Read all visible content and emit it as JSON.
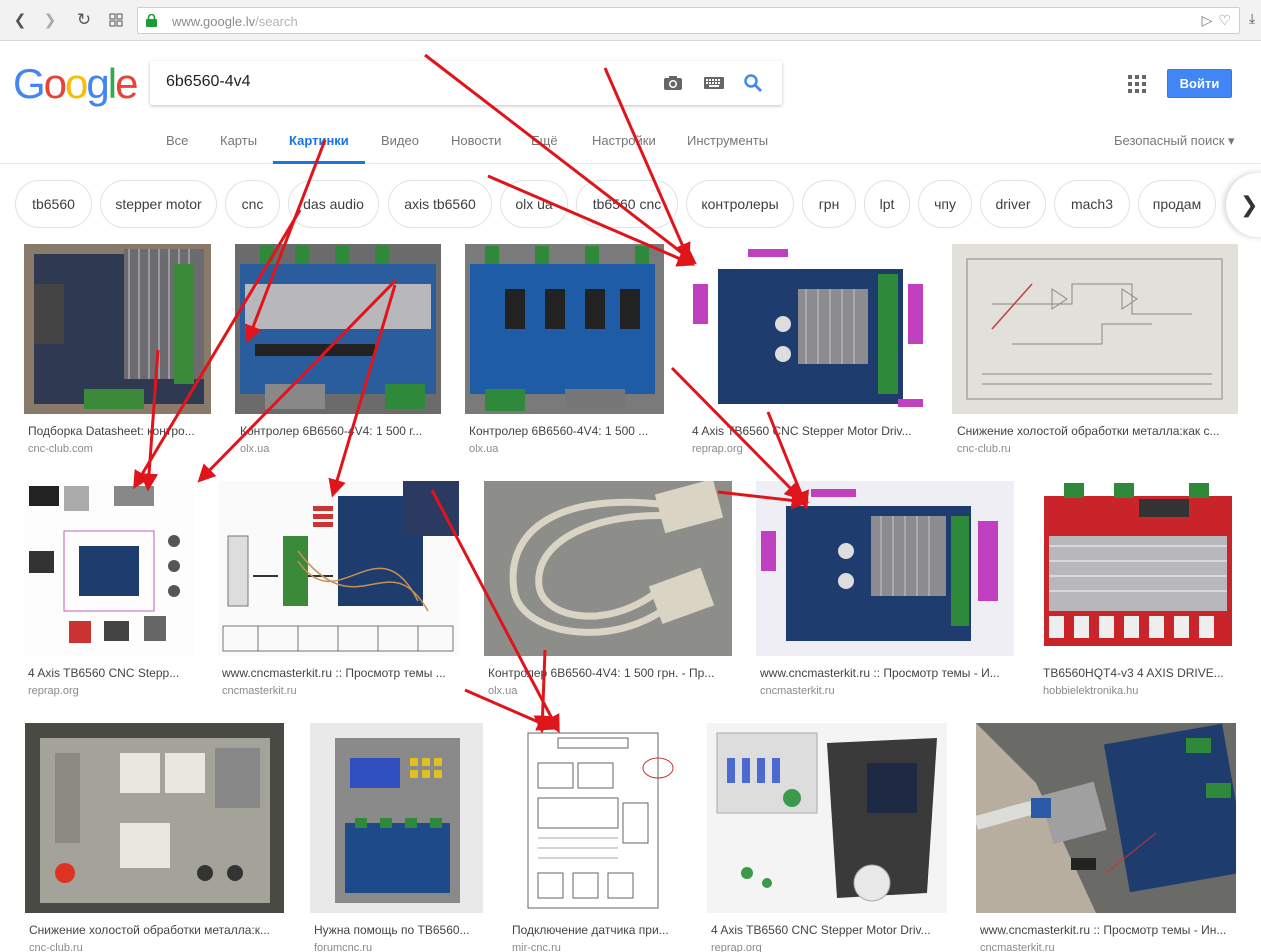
{
  "browser": {
    "url_host": "www.google.lv",
    "url_path": "/search"
  },
  "logo": [
    "G",
    "o",
    "o",
    "g",
    "l",
    "e"
  ],
  "logo_colors": [
    "#4285f4",
    "#ea4335",
    "#fbbc05",
    "#4285f4",
    "#34a853",
    "#ea4335"
  ],
  "search": {
    "query": "6b6560-4v4"
  },
  "header": {
    "signin_label": "Войти"
  },
  "tabs": [
    {
      "label": "Все"
    },
    {
      "label": "Карты"
    },
    {
      "label": "Картинки",
      "active": true
    },
    {
      "label": "Видео"
    },
    {
      "label": "Новости"
    },
    {
      "label": "Ещё"
    },
    {
      "label": "Настройки"
    },
    {
      "label": "Инструменты"
    }
  ],
  "safe_search": "Безопасный поиск ▾",
  "chips": [
    "tb6560",
    "stepper motor",
    "cnc",
    "das audio",
    "axis tb6560",
    "olx ua",
    "tb6560 cnc",
    "контролеры",
    "грн",
    "lpt",
    "чпу",
    "driver",
    "mach3",
    "продам"
  ],
  "results": [
    {
      "caption": "Подборка Datasheet: контро...",
      "source": "cnc-club.com"
    },
    {
      "caption": "Контролер 6В6560-4V4: 1 500 г...",
      "source": "olx.ua"
    },
    {
      "caption": "Контролер 6В6560-4V4: 1 500 ...",
      "source": "olx.ua"
    },
    {
      "caption": "4 Axis TB6560 CNC Stepper Motor Driv...",
      "source": "reprap.org"
    },
    {
      "caption": "Снижение холостой обработки металла:как с...",
      "source": "cnc-club.ru"
    },
    {
      "caption": "4 Axis TB6560 CNC Stepp...",
      "source": "reprap.org"
    },
    {
      "caption": "www.cncmasterkit.ru :: Просмотр темы ...",
      "source": "cncmasterkit.ru"
    },
    {
      "caption": "Контролер 6В6560-4V4: 1 500 грн. - Пр...",
      "source": "olx.ua"
    },
    {
      "caption": "www.cncmasterkit.ru :: Просмотр темы - И...",
      "source": "cncmasterkit.ru"
    },
    {
      "caption": "TB6560HQT4-v3 4 AXIS DRIVE...",
      "source": "hobbielektronika.hu"
    },
    {
      "caption": "Снижение холостой обработки металла:к...",
      "source": "cnc-club.ru"
    },
    {
      "caption": "Нужна помощь по TB6560...",
      "source": "forumcnc.ru"
    },
    {
      "caption": "Подключение датчика при...",
      "source": "mir-cnc.ru"
    },
    {
      "caption": "4 Axis TB6560 CNC Stepper Motor Driv...",
      "source": "reprap.org"
    },
    {
      "caption": "www.cncmasterkit.ru :: Просмотр темы - Ин...",
      "source": "cncmasterkit.ru"
    }
  ],
  "annotation_color": "#e0151b"
}
